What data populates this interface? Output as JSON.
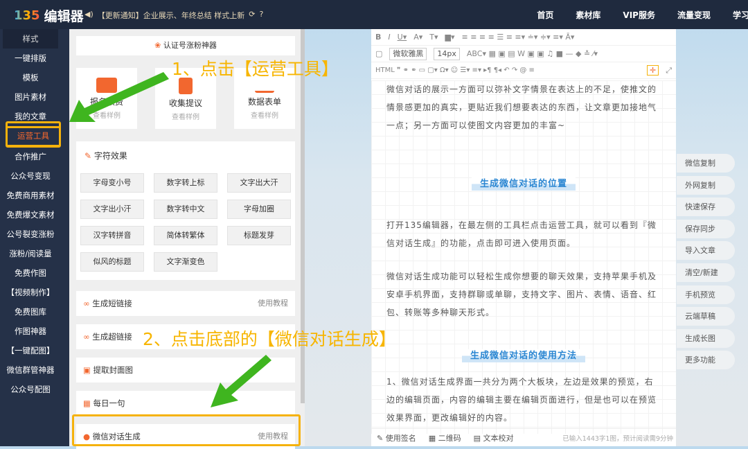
{
  "header": {
    "logo_num": "135",
    "logo_text": "编辑器",
    "notice": "【更新通知】企业展示、年终总结 样式上新",
    "nav": [
      "首页",
      "素材库",
      "VIP服务",
      "流量变现",
      "学习"
    ]
  },
  "sidebar": {
    "items": [
      "样式",
      "一键排版",
      "模板",
      "图片素材",
      "我的文章",
      "运营工具",
      "合作推广",
      "公众号变现",
      "免费商用素材",
      "免费爆文素材",
      "公号裂变涨粉",
      "涨粉/阅读量",
      "免费作图",
      "【视频制作】",
      "免费图库",
      "作图神器",
      "【一键配图】",
      "微信群管神器",
      "公众号配图"
    ]
  },
  "panel": {
    "fans_label": "认证号涨粉神器",
    "tools": [
      {
        "title": "报名收费",
        "sub": "查看样例"
      },
      {
        "title": "收集提议",
        "sub": "查看样例"
      },
      {
        "title": "数据表单",
        "sub": "查看样例"
      }
    ],
    "effects_title": "字符效果",
    "effects": [
      "字母变小号",
      "数字转上标",
      "文字出大汗",
      "文字出小汗",
      "数字转中文",
      "字母加圈",
      "汉字转拼音",
      "简体转繁体",
      "标题发芽",
      "似风的标题",
      "文字渐变色"
    ],
    "rows": [
      {
        "label": "生成短链接",
        "right": "使用教程"
      },
      {
        "label": "生成超链接"
      },
      {
        "label": "提取封面图"
      },
      {
        "label": "每日一句"
      },
      {
        "label": "微信对话生成",
        "right": "使用教程"
      }
    ]
  },
  "editor": {
    "font": "微软雅黑",
    "size": "14px",
    "p1": "微信对话的展示一方面可以弥补文字情景在表达上的不足，使推文的情景感更加的真实，更贴近我们想要表达的东西，让文章更加接地气一点；另一方面可以使图文内容更加的丰富~",
    "h1": "生成微信对话的位置",
    "p2": "打开135编辑器，在最左侧的工具栏点击运营工具，就可以看到『微信对话生成』的功能，点击即可进入使用页面。",
    "p3": "微信对话生成功能可以轻松生成你想要的聊天效果，支持苹果手机及安卓手机界面，支持群聊或单聊，支持文字、图片、表情、语音、红包、转账等多种聊天形式。",
    "h2": "生成微信对话的使用方法",
    "p4": "1、微信对话生成界面一共分为两个大板块，左边是效果的预览，右边的编辑页面，内容的编辑主要在编辑页面进行，但是也可以在预览效果界面，更改编辑好的内容。",
    "footer": [
      "使用签名",
      "二维码",
      "文本校对"
    ],
    "count": "已输入1443字1图，预计阅读需9分钟"
  },
  "right_buttons": [
    "微信复制",
    "外网复制",
    "快速保存",
    "保存同步",
    "导入文章",
    "清空/新建",
    "手机预览",
    "云端草稿",
    "生成长图",
    "更多功能"
  ],
  "annotations": {
    "step1": "1、点击【运营工具】",
    "step2": "2、点击底部的【微信对话生成】"
  },
  "colors": {
    "header": "#1f2a3e",
    "accent": "#f5b20c",
    "arrow": "#3fb51f"
  }
}
